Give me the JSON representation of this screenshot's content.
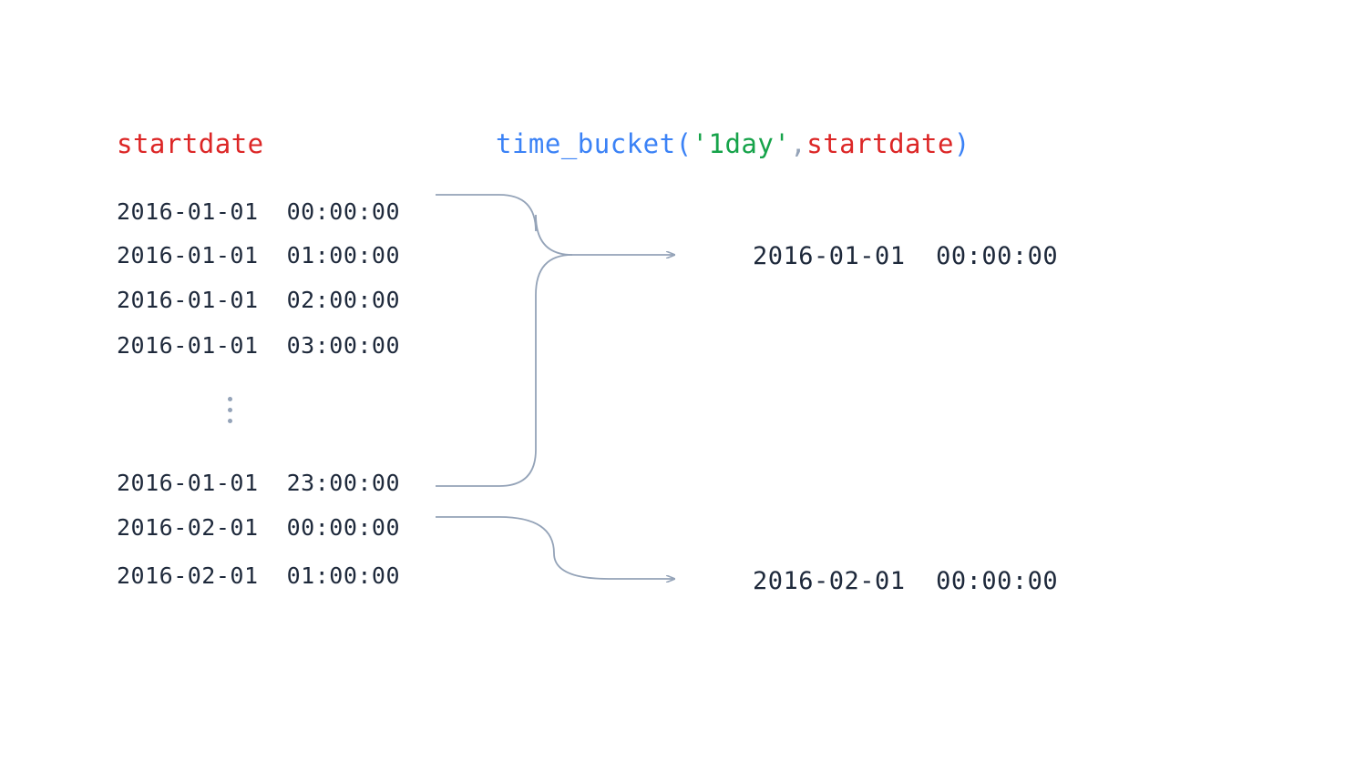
{
  "left_header": "startdate",
  "rows": {
    "r1": "2016-01-01  00:00:00",
    "r2": "2016-01-01  01:00:00",
    "r3": "2016-01-01  02:00:00",
    "r4": "2016-01-01  03:00:00",
    "r5": "2016-01-01  23:00:00",
    "r6": "2016-02-01  00:00:00",
    "r7": "2016-02-01  01:00:00"
  },
  "right_header": {
    "fn": "time_bucket",
    "open": "(",
    "strlit": "'1day'",
    "comma": ",",
    "arg": "startdate",
    "close": ")"
  },
  "outputs": {
    "o1": "2016-01-01  00:00:00",
    "o2": "2016-02-01  00:00:00"
  }
}
